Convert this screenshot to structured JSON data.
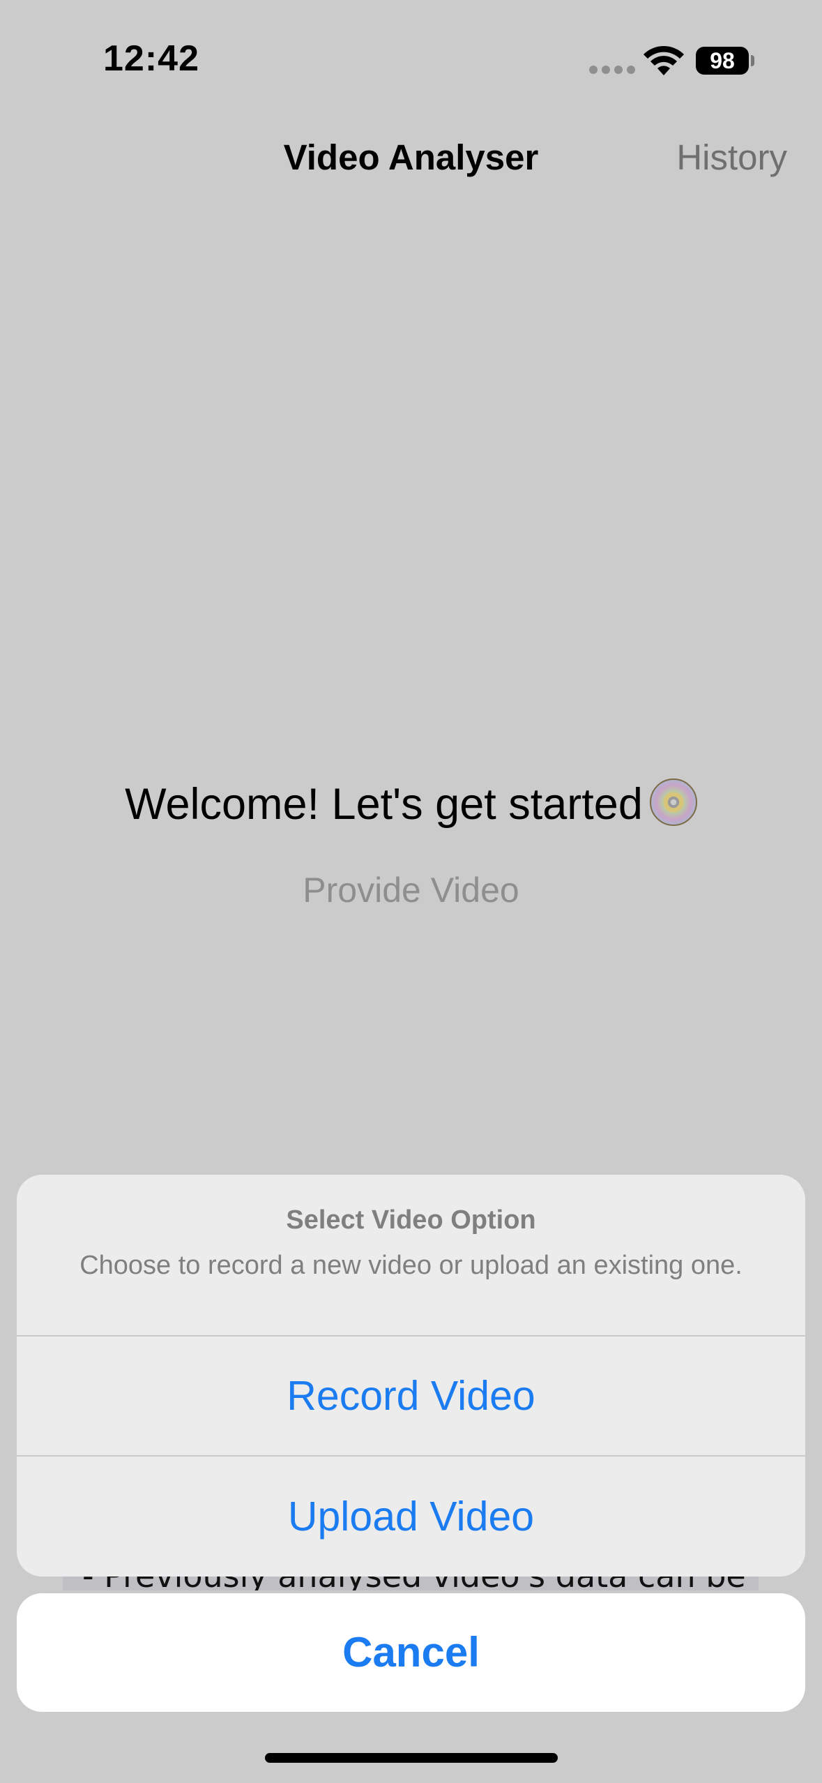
{
  "status_bar": {
    "time": "12:42",
    "battery": "98"
  },
  "nav": {
    "title": "Video Analyser",
    "history_label": "History"
  },
  "main": {
    "welcome_text": "Welcome! Let's get started",
    "provide_video_label": "Provide Video",
    "behind_text": "- Previously analysed video's data can be"
  },
  "action_sheet": {
    "title": "Select Video Option",
    "message": "Choose to record a new video or upload an existing one.",
    "actions": [
      {
        "label": "Record Video"
      },
      {
        "label": "Upload Video"
      }
    ],
    "cancel_label": "Cancel"
  },
  "colors": {
    "accent": "#1a7cf0",
    "dimmed_background": "#cbcbcb"
  }
}
